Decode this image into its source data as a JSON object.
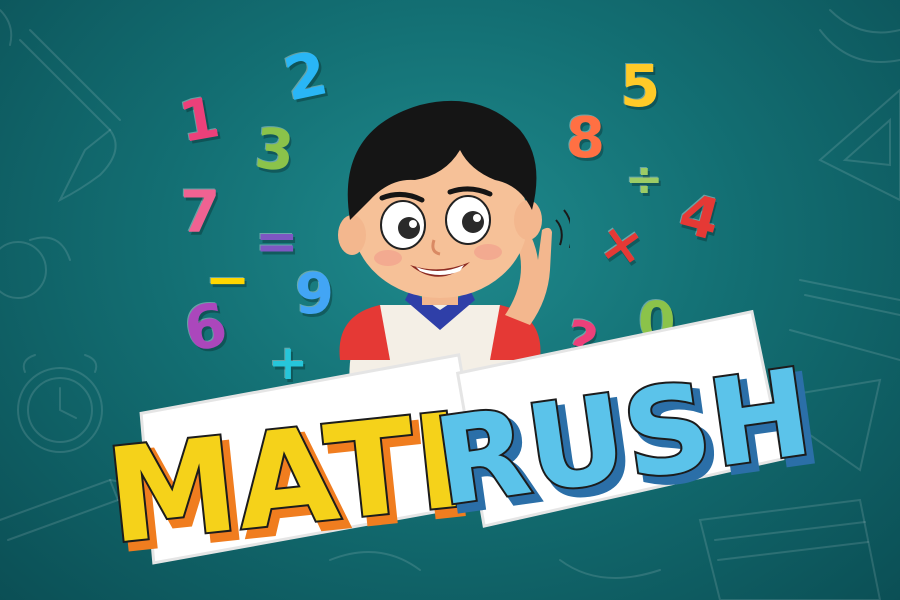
{
  "game": {
    "title_word1": "MATH",
    "title_word2": "RUSH"
  },
  "colors": {
    "background": "#136f73",
    "math_yellow": "#f5d21a",
    "rush_blue": "#5bc3ea",
    "title_outline": "#ffffff"
  },
  "symbols": [
    {
      "id": "n1",
      "text": "1",
      "color": "#ec407a"
    },
    {
      "id": "n2",
      "text": "2",
      "color": "#29b6f6"
    },
    {
      "id": "n3",
      "text": "3",
      "color": "#8bc34a"
    },
    {
      "id": "n7",
      "text": "7",
      "color": "#f06292"
    },
    {
      "id": "eq",
      "text": "=",
      "color": "#7e57c2"
    },
    {
      "id": "minus",
      "text": "−",
      "color": "#ffd600"
    },
    {
      "id": "n9",
      "text": "9",
      "color": "#42a5f5"
    },
    {
      "id": "n6",
      "text": "6",
      "color": "#ab47bc"
    },
    {
      "id": "plus",
      "text": "+",
      "color": "#26c6da"
    },
    {
      "id": "n5",
      "text": "5",
      "color": "#ffca28"
    },
    {
      "id": "n8",
      "text": "8",
      "color": "#ff7043"
    },
    {
      "id": "div",
      "text": "÷",
      "color": "#9ccc65"
    },
    {
      "id": "times",
      "text": "×",
      "color": "#e53935"
    },
    {
      "id": "n4",
      "text": "4",
      "color": "#e53935"
    },
    {
      "id": "q",
      "text": "?",
      "color": "#ec407a"
    },
    {
      "id": "n0",
      "text": "0",
      "color": "#8bc34a"
    }
  ],
  "icons": [
    "character-boy-icon",
    "paintbrush-doodle-icon",
    "alarm-clock-doodle-icon",
    "pencil-doodle-icon",
    "triangle-ruler-doodle-icon",
    "notebook-doodle-icon"
  ]
}
